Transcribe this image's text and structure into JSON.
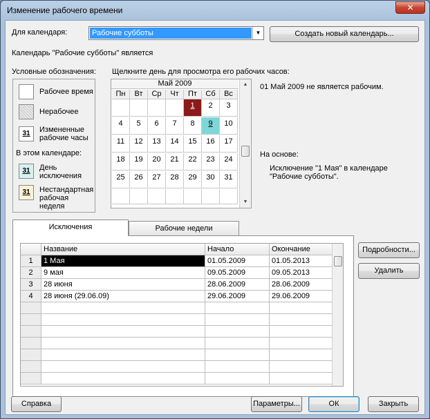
{
  "window": {
    "title": "Изменение рабочего времени",
    "close_glyph": "✕"
  },
  "calendar_select": {
    "label": "Для календаря:",
    "value": "Рабочие субботы",
    "arrow": "▼"
  },
  "buttons": {
    "create_calendar": "Создать новый календарь...",
    "details": "Подробности...",
    "delete": "Удалить",
    "help": "Справка",
    "options": "Параметры...",
    "ok": "ОК",
    "close": "Закрыть"
  },
  "calendar_note": "Календарь \"Рабочие субботы\" является",
  "legend": {
    "title": "Условные обозначения:",
    "working": "Рабочее время",
    "nonworking": "Нерабочее",
    "changed_line1": "Измененные",
    "changed_line2": "рабочие часы",
    "in_this_calendar": "В этом календаре:",
    "exception_line1": "День",
    "exception_line2": "исключения",
    "nondefault_line1": "Нестандартная",
    "nondefault_line2": "рабочая неделя",
    "swatch_number": "31"
  },
  "calendar": {
    "instruction": "Щелкните день для просмотра его рабочих часов:",
    "month": "Май 2009",
    "weekdays": [
      "Пн",
      "Вт",
      "Ср",
      "Чт",
      "Пт",
      "Сб",
      "Вс"
    ],
    "weeks": [
      [
        "",
        "",
        "",
        "",
        "1",
        "2",
        "3"
      ],
      [
        "4",
        "5",
        "6",
        "7",
        "8",
        "9",
        "10"
      ],
      [
        "11",
        "12",
        "13",
        "14",
        "15",
        "16",
        "17"
      ],
      [
        "18",
        "19",
        "20",
        "21",
        "22",
        "23",
        "24"
      ],
      [
        "25",
        "26",
        "27",
        "28",
        "29",
        "30",
        "31"
      ]
    ],
    "colors": {
      "exception": "#8b1a1a",
      "changed": "#7fd6d6",
      "nonworking_hatch": "#c8c8c8"
    }
  },
  "info": {
    "day_status": "01 Май 2009 не является рабочим.",
    "based_on_label": "На основе:",
    "based_on_line1": "Исключение \"1 Мая\" в календаре",
    "based_on_line2": "\"Рабочие субботы\"."
  },
  "tabs": {
    "exceptions": "Исключения",
    "work_weeks": "Рабочие недели"
  },
  "exceptions_table": {
    "headers": [
      "Название",
      "Начало",
      "Окончание"
    ],
    "rows": [
      {
        "num": "1",
        "name": "1 Мая",
        "start": "01.05.2009",
        "end": "01.05.2013"
      },
      {
        "num": "2",
        "name": "9 мая",
        "start": "09.05.2009",
        "end": "09.05.2013"
      },
      {
        "num": "3",
        "name": "28 июня",
        "start": "28.06.2009",
        "end": "28.06.2009"
      },
      {
        "num": "4",
        "name": "28 июня (29.06.09)",
        "start": "29.06.2009",
        "end": "29.06.2009"
      }
    ]
  },
  "scroll_arrows": {
    "up": "▲",
    "down": "▼"
  }
}
